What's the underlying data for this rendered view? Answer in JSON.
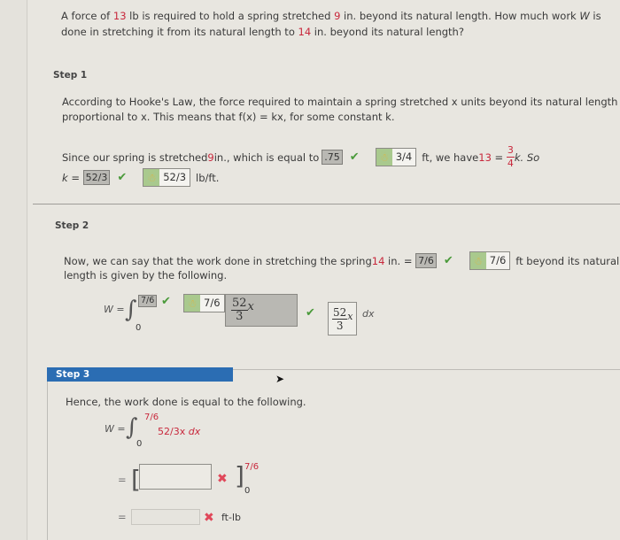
{
  "question": {
    "part1": "A force of ",
    "force": "13",
    "part2": " lb is required to hold a spring stretched ",
    "stretch": "9",
    "part3": " in. beyond its natural length. How much work ",
    "var_w": "W",
    "part4": " is",
    "line2a": "done in stretching it from its natural length to ",
    "target": "14",
    "line2b": " in. beyond its natural length?"
  },
  "step1": {
    "label": "Step 1",
    "hooke_line1": "According to Hooke's Law, the force required to maintain a spring stretched x units beyond its natural length is",
    "hooke_line2": "proportional to x. This means that f(x) = kx, for some constant k.",
    "since_a": "Since our spring is stretched ",
    "since_num": "9",
    "since_b": " in., which is equal to ",
    "answer_ft": ".75",
    "key_ft": "3/4",
    "since_c": " ft, we have ",
    "force": "13",
    "equals": " = ",
    "frac_num": "3",
    "frac_den": "4",
    "since_d": "k. So",
    "k_label": "k = ",
    "answer_k": "52/3",
    "key_k": "52/3",
    "k_unit": "lb/ft."
  },
  "step2": {
    "label": "Step 2",
    "line1a": "Now, we can say that the work done in stretching the spring ",
    "line1_num": "14",
    "line1b": " in. = ",
    "answer_ft": "7/6",
    "key_ft": "7/6",
    "line1c": "ft beyond its natural",
    "line2": "length is given by the following.",
    "w_label": "W =",
    "lower": "0",
    "answer_upper": "7/6",
    "key_upper": "7/6",
    "integrand_num": "52",
    "integrand_den": "3",
    "integrand_var": "x",
    "dx": "dx"
  },
  "step3": {
    "label": "Step 3",
    "line1": "Hence, the work done is equal to the following.",
    "w_label": "W =",
    "upper": "7/6",
    "lower": "0",
    "integrand": "52/3x",
    "dx": "dx",
    "eq": "=",
    "eval_upper": "7/6",
    "eval_lower": "0",
    "antiderivative_value": "",
    "final_value": "",
    "unit": "ft-lb"
  },
  "icons": {
    "check": "✔",
    "cross": "✖",
    "key": "🔑"
  }
}
